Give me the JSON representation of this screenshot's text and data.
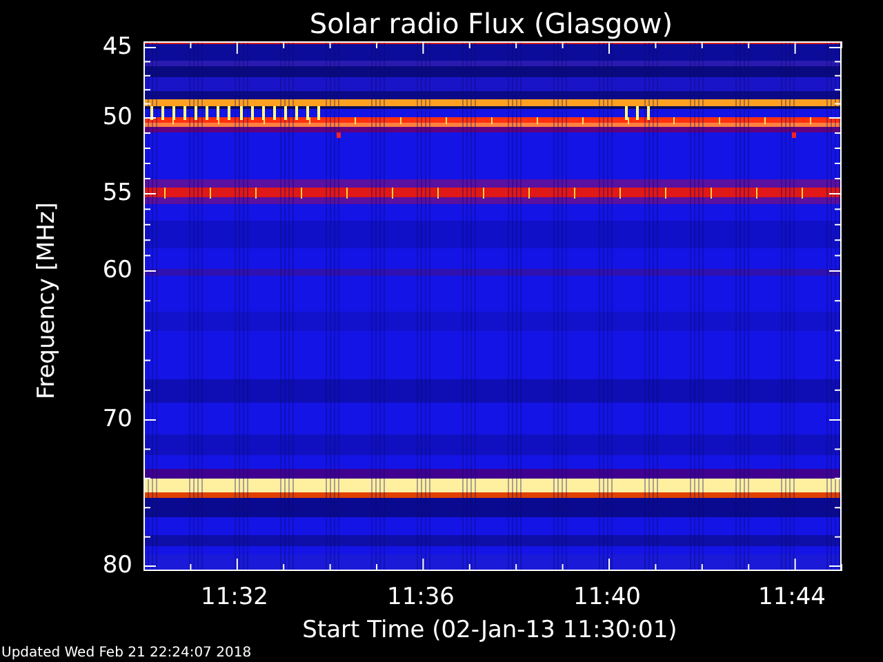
{
  "title": "Solar radio Flux (Glasgow)",
  "y_axis": {
    "title": "Frequency [MHz]",
    "ticks": [
      "45",
      "50",
      "55",
      "60",
      "70",
      "80"
    ]
  },
  "x_axis": {
    "title": "Start Time (02-Jan-13 11:30:01)",
    "ticks": [
      "11:32",
      "11:36",
      "11:40",
      "11:44"
    ]
  },
  "footer": "Updated Wed Feb 21 22:24:07 2018"
}
